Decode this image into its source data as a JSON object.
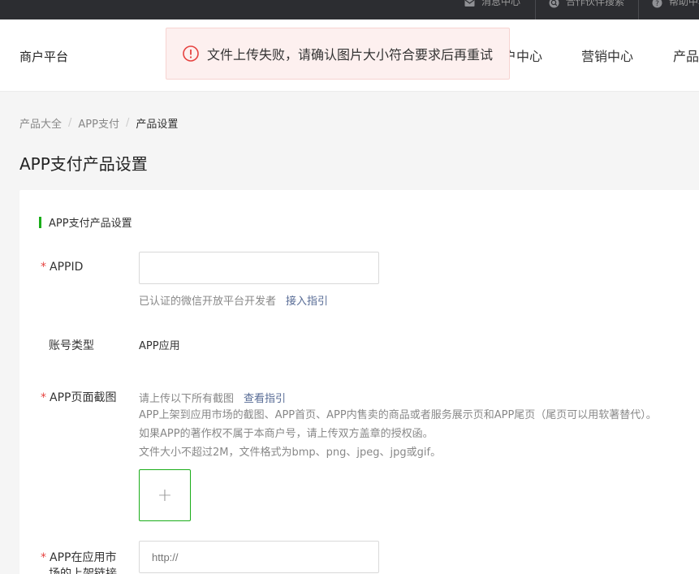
{
  "topbar": {
    "items": [
      {
        "label": "消息中心",
        "icon": "mail-icon"
      },
      {
        "label": "合作伙伴搜索",
        "icon": "search-icon"
      },
      {
        "label": "帮助中心",
        "icon": "help-icon"
      }
    ]
  },
  "header": {
    "brand": "商户平台",
    "nav": [
      {
        "label": "户中心"
      },
      {
        "label": "营销中心"
      },
      {
        "label": "产品"
      }
    ]
  },
  "toast": {
    "icon": "error-circle-icon",
    "message": "文件上传失败，请确认图片大小符合要求后再重试"
  },
  "breadcrumb": {
    "items": [
      "产品大全",
      "APP支付",
      "产品设置"
    ],
    "separator": "/"
  },
  "page": {
    "title": "APP支付产品设置"
  },
  "form": {
    "section_title": "APP支付产品设置",
    "required_mark": "*",
    "appid": {
      "label": "APPID",
      "value": "",
      "hint": "已认证的微信开放平台开发者",
      "hint_link": "接入指引"
    },
    "account_type": {
      "label": "账号类型",
      "value": "APP应用"
    },
    "screenshots": {
      "label": "APP页面截图",
      "hint": "请上传以下所有截图",
      "hint_link": "查看指引",
      "desc_lines": [
        "APP上架到应用市场的截图、APP首页、APP内售卖的商品或者服务展示页和APP尾页（尾页可以用软著替代）。",
        "如果APP的著作权不属于本商户号，请上传双方盖章的授权函。",
        "文件大小不超过2M，文件格式为bmp、png、jpeg、jpg或gif。"
      ],
      "upload_symbol": "+"
    },
    "market_link": {
      "label_line1": "APP在应用市",
      "label_line2": "场的上架链接",
      "placeholder": "http://"
    }
  },
  "colors": {
    "accent": "#1aad19",
    "link": "#576b95",
    "error": "#e64340",
    "topbar_bg": "#2c2d31"
  }
}
